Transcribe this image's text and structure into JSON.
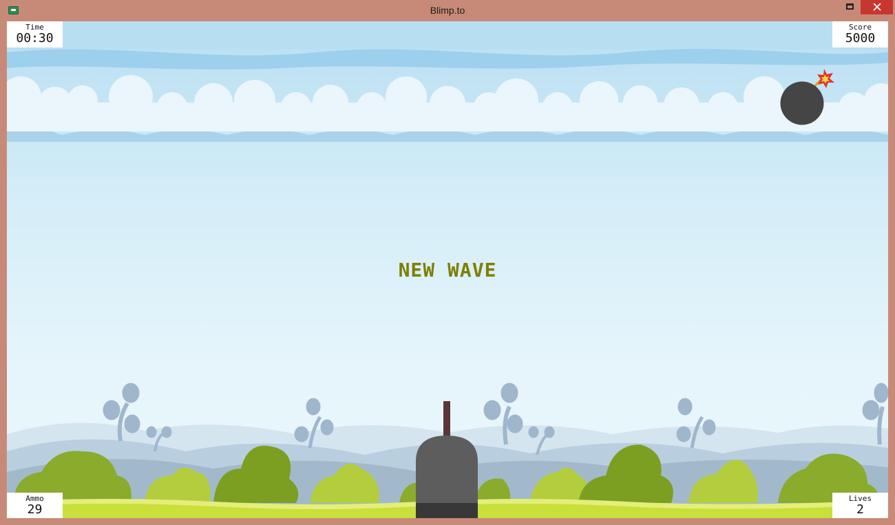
{
  "window": {
    "title": "Blimp.to"
  },
  "hud": {
    "time_label": "Time",
    "time_value": "00:30",
    "score_label": "Score",
    "score_value": "5000",
    "ammo_label": "Ammo",
    "ammo_value": "29",
    "lives_label": "Lives",
    "lives_value": "2"
  },
  "message": "NEW WAVE",
  "colors": {
    "window_frame": "#c88a78",
    "message": "#7f7f00",
    "sky_top": "#b8def2",
    "grass": "#c9df3a",
    "bomb": "#454545",
    "cannon": "#5a5a5a"
  },
  "icons": [
    "app-icon",
    "minimize-icon",
    "restore-icon",
    "close-icon",
    "bomb-icon"
  ]
}
